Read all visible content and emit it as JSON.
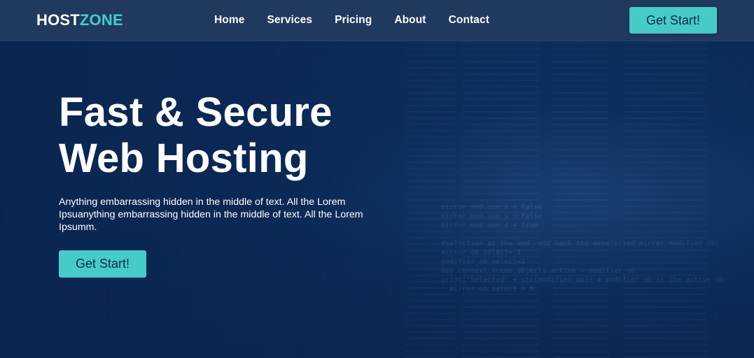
{
  "brand": {
    "logo_part1": "HOST",
    "logo_part2": "ZONE",
    "accent_color": "#45ccc8",
    "background_color": "#0b2a55"
  },
  "nav": {
    "items": [
      {
        "label": "Home"
      },
      {
        "label": "Services"
      },
      {
        "label": "Pricing"
      },
      {
        "label": "About"
      },
      {
        "label": "Contact"
      }
    ],
    "cta_label": "Get Start!"
  },
  "hero": {
    "title_line1": "Fast & Secure",
    "title_line2": "Web Hosting",
    "description": "Anything embarrassing hidden in the middle of text. All the Lorem Ipsuanything embarrassing hidden in the middle of text. All the Lorem Ipsumm.",
    "cta_label": "Get Start!"
  }
}
